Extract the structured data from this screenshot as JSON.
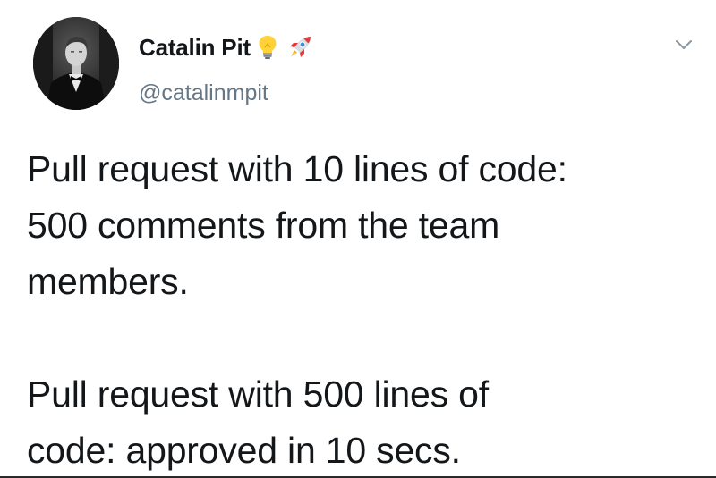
{
  "tweet": {
    "author": {
      "display_name": "Catalin Pit",
      "handle": "@catalinmpit",
      "badges": [
        "lightbulb-emoji",
        "rocket-emoji"
      ]
    },
    "menu_icon": "chevron-down-icon",
    "paragraphs": [
      [
        "Pull request with 10 lines of code:",
        "500 comments from the team",
        "members."
      ],
      [
        "Pull request with 500 lines of",
        "code: approved in 10 secs."
      ]
    ]
  },
  "colors": {
    "text": "#14171a",
    "handle": "#657786",
    "background": "#ffffff"
  }
}
